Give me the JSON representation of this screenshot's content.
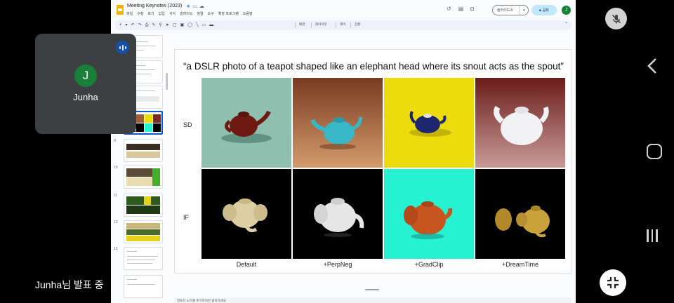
{
  "doc": {
    "title": "Meeting Keynotes (2023)",
    "menus": [
      "파일",
      "수정",
      "보기",
      "삽입",
      "서식",
      "슬라이드",
      "정렬",
      "도구",
      "확장 프로그램",
      "도움말"
    ],
    "slideshow_label": "슬라이드쇼",
    "share_label": "공유",
    "user_initial": "J",
    "toolbar_text": [
      "배경",
      "레이아웃",
      "테마",
      "전환"
    ]
  },
  "filmstrip": {
    "slide_numbers": [
      "9",
      "10",
      "11",
      "12",
      "13"
    ],
    "selected_index": 3
  },
  "slide": {
    "quote": "“a DSLR photo of a teapot shaped like an elephant head where its snout acts as the spout”",
    "row_labels": [
      "SD",
      "IF"
    ],
    "col_labels": [
      "Default",
      "+PerpNeg",
      "+GradClip",
      "+DreamTime"
    ],
    "colors": {
      "sd_backgrounds": [
        "#8fbfae",
        "#a2603a",
        "#ecdc0e",
        "#7a2c26"
      ],
      "if_backgrounds": [
        "#000000",
        "#000000",
        "#26f2d2",
        "#000000"
      ]
    }
  },
  "speaker_notes": "발표자 노트를 추가하려면 클릭하세요",
  "meet": {
    "participant_initial": "J",
    "participant_name": "Junha",
    "presenting_text": "Junha님 발표 중"
  }
}
